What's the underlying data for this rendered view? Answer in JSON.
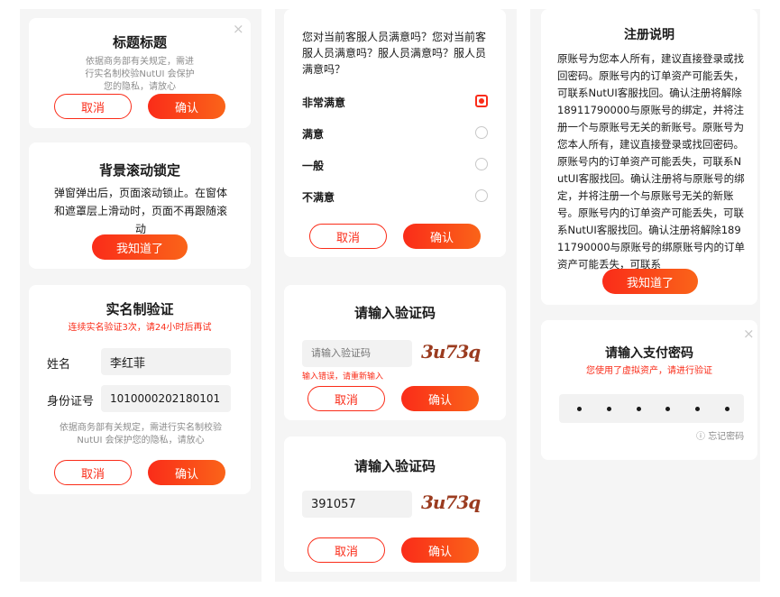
{
  "privacy_dialog": {
    "title": "标题标题",
    "text": "依据商务部有关规定，需进行实名制校验NutUI 会保护您的隐私，请放心",
    "close_icon": "×",
    "cancel": "取消",
    "confirm": "确认"
  },
  "scroll_lock_dialog": {
    "title": "背景滚动锁定",
    "text": "弹窗弹出后，页面滚动锁止。在窗体和遮罩层上滑动时，页面不再跟随滚动",
    "ok": "我知道了"
  },
  "realname_dialog": {
    "title": "实名制验证",
    "warning": "连续实名验证3次，请24小时后再试",
    "name_label": "姓名",
    "name_value": "李红菲",
    "id_label": "身份证号",
    "id_value": "1010000202180101",
    "note": "依据商务部有关规定，需进行实名制校验NutUI 会保护您的隐私，请放心",
    "cancel": "取消",
    "confirm": "确认"
  },
  "survey_dialog": {
    "question": "您对当前客服人员满意吗？您对当前客服人员满意吗？服人员满意吗？服人员满意吗？",
    "options": [
      "非常满意",
      "满意",
      "一般",
      "不满意"
    ],
    "selected": 0,
    "cancel": "取消",
    "confirm": "确认"
  },
  "captcha_dialog_error": {
    "title": "请输入验证码",
    "placeholder": "请输入验证码",
    "captcha_text": "3u73q",
    "error": "输入错误，请重新输入",
    "cancel": "取消",
    "confirm": "确认"
  },
  "captcha_dialog_filled": {
    "title": "请输入验证码",
    "value": "391057",
    "captcha_text": "3u73q",
    "cancel": "取消",
    "confirm": "确认"
  },
  "register_dialog": {
    "title": "注册说明",
    "text": "原账号为您本人所有，建议直接登录或找回密码。原账号内的订单资产可能丢失，可联系NutUI客服找回。确认注册将解除18911790000与原账号的绑定，并将注册一个与原账号无关的新账号。原账号为您本人所有，建议直接登录或找回密码。原账号内的订单资产可能丢失，可联系NutUI客服找回。确认注册将与原账号的绑定，并将注册一个与原账号无关的新账号。原账号内的订单资产可能丢失，可联系NutUI客服找回。确认注册将解除18911790000与原账号的绑原账号内的订单资产可能丢失，可联系",
    "ok": "我知道了"
  },
  "pay_password_dialog": {
    "title": "请输入支付密码",
    "subtitle": "您使用了虚拟资产，请进行验证",
    "close_icon": "×",
    "forgot_icon": "ⓘ",
    "forgot": "忘记密码"
  },
  "colors": {
    "accent": "#fa2c19",
    "accent_end": "#fa6419"
  }
}
